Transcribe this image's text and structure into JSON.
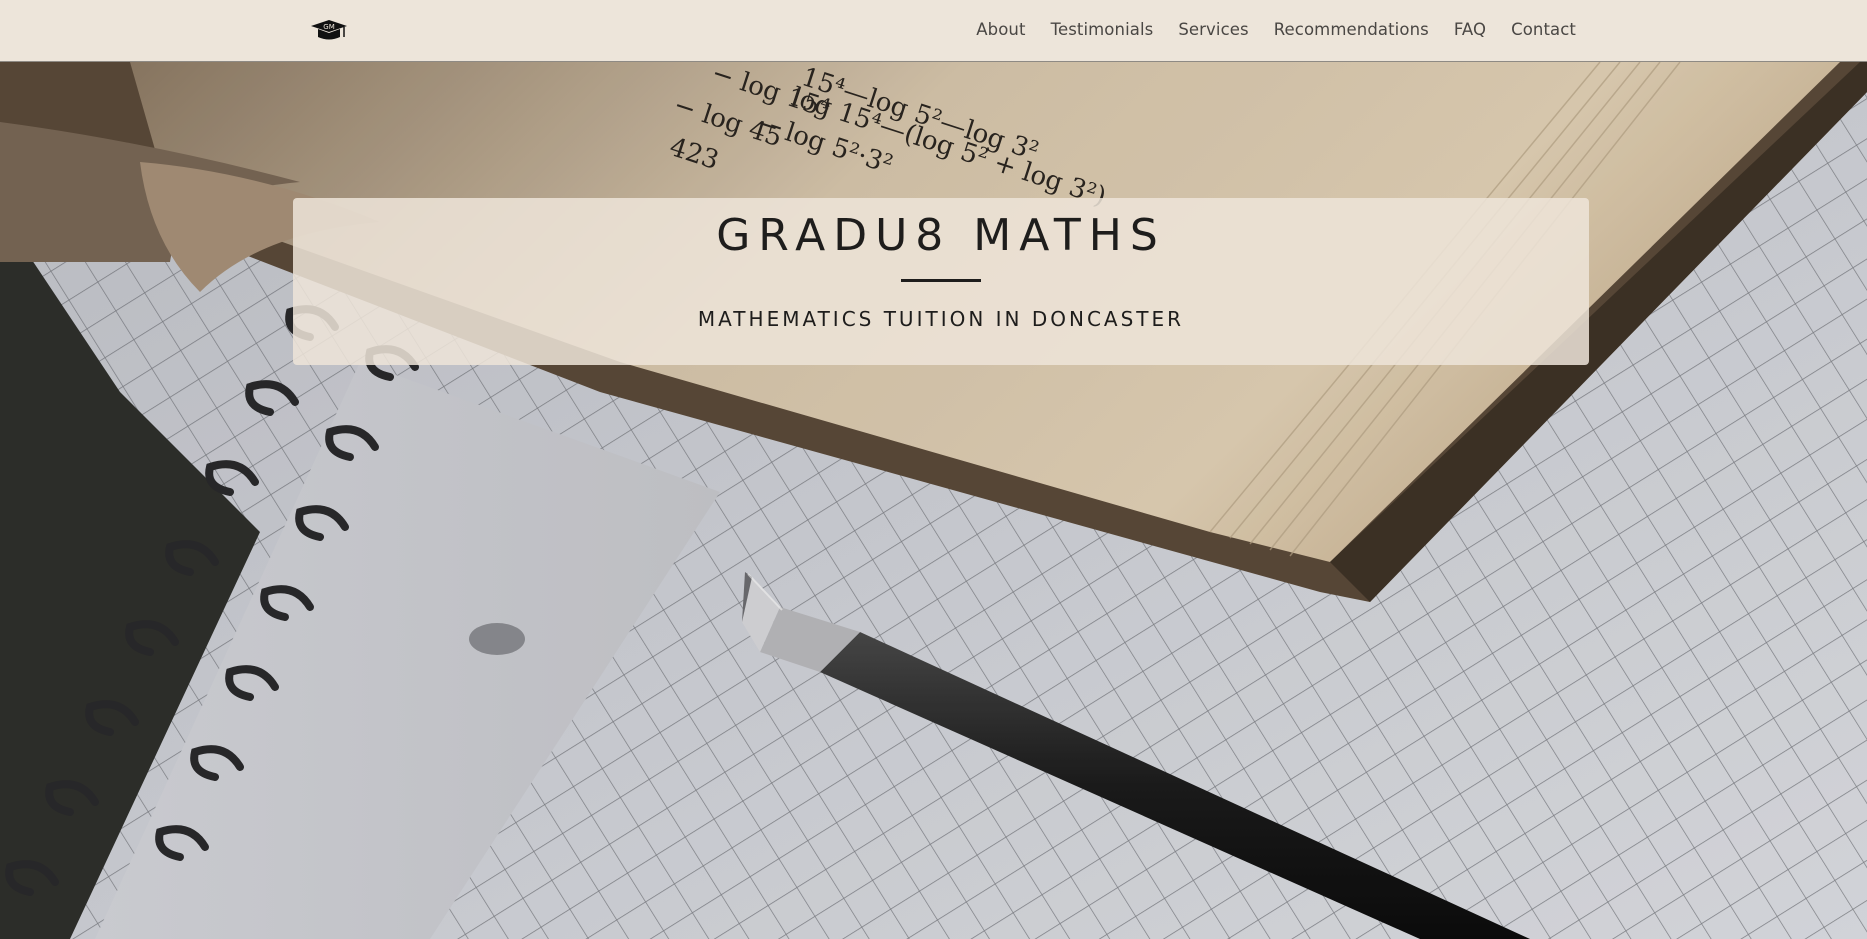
{
  "nav": {
    "logo_icon": "graduation-cap-icon",
    "logo_text": "GM",
    "links": [
      "About",
      "Testimonials",
      "Services",
      "Recommendations",
      "FAQ",
      "Contact"
    ]
  },
  "hero": {
    "title": "GRADU8 MATHS",
    "subtitle": "MATHEMATICS TUITION IN DONCASTER",
    "book_text": [
      "15⁴—log 5²—log 3²",
      "log 15⁴—(log 5² + log 3²)",
      "− log 15⁴",
      "− log 5²·3²",
      "− log 45",
      "423"
    ]
  },
  "colors": {
    "navbar_bg": "#ede5da",
    "panel_bg": "#ede4d8",
    "text_dark": "#1e1d1c",
    "nav_text": "#4a4744"
  }
}
